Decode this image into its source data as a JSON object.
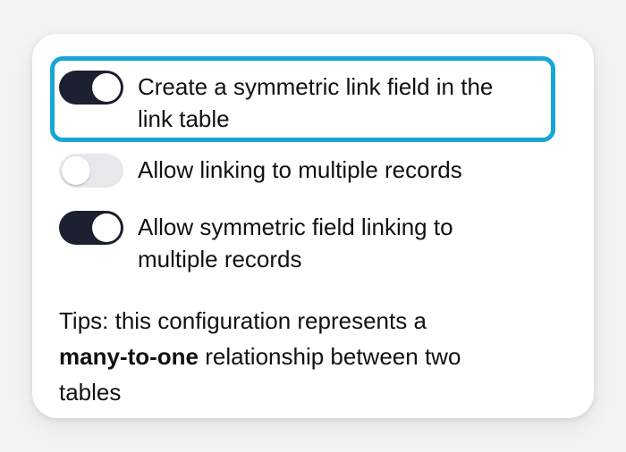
{
  "options": [
    {
      "label_line1": "Create a symmetric link field in the",
      "label_line2": "link table",
      "state": "on"
    },
    {
      "label_line1": "Allow linking to multiple records",
      "label_line2": "",
      "state": "off"
    },
    {
      "label_line1": "Allow symmetric field linking to",
      "label_line2": "multiple records",
      "state": "on"
    }
  ],
  "tips": {
    "prefix": "Tips: this configuration represents a",
    "bold": "many-to-one",
    "suffix": " relationship between two",
    "last_line": "tables"
  },
  "colors": {
    "highlight_border": "#18a6d6",
    "toggle_on": "#1c2030",
    "toggle_off": "#e6e8ec"
  }
}
